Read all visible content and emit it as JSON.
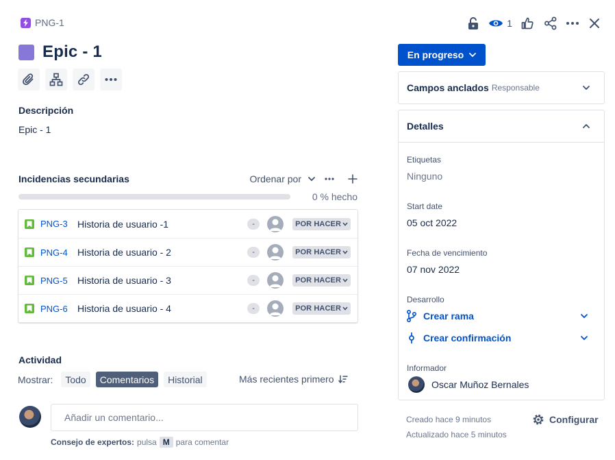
{
  "breadcrumb": {
    "key": "PNG-1"
  },
  "top_actions": {
    "watch_count": "1"
  },
  "issue": {
    "title": "Epic - 1"
  },
  "description": {
    "label": "Descripción",
    "text": "Epic - 1"
  },
  "child_issues": {
    "label": "Incidencias secundarias",
    "sort_label": "Ordenar por",
    "progress_percent": 0,
    "progress_label": "0 % hecho",
    "items": [
      {
        "key": "PNG-3",
        "summary": "Historia de usuario -1",
        "priority": "-",
        "status": "POR HACER"
      },
      {
        "key": "PNG-4",
        "summary": "Historia de usuario - 2",
        "priority": "-",
        "status": "POR HACER"
      },
      {
        "key": "PNG-5",
        "summary": "Historia de usuario - 3",
        "priority": "-",
        "status": "POR HACER"
      },
      {
        "key": "PNG-6",
        "summary": "Historia de usuario - 4",
        "priority": "-",
        "status": "POR HACER"
      }
    ]
  },
  "activity": {
    "label": "Actividad",
    "show_label": "Mostrar:",
    "filters": [
      "Todo",
      "Comentarios",
      "Historial"
    ],
    "active_filter": "Comentarios",
    "sort_label": "Más recientes primero",
    "comment_placeholder": "Añadir un comentario...",
    "tip_bold": "Consejo de expertos:",
    "tip_pre": "pulsa",
    "tip_key": "M",
    "tip_post": "para comentar"
  },
  "sidebar": {
    "status_button": "En progreso",
    "pinned_title": "Campos anclados",
    "pinned_subtitle": "Responsable",
    "details_title": "Detalles",
    "labels_label": "Etiquetas",
    "labels_value": "Ninguno",
    "start_date_label": "Start date",
    "start_date_value": "05 oct 2022",
    "due_date_label": "Fecha de vencimiento",
    "due_date_value": "07 nov 2022",
    "development_label": "Desarrollo",
    "create_branch": "Crear rama",
    "create_commit": "Crear confirmación",
    "reporter_label": "Informador",
    "reporter_name": "Oscar Muñoz Bernales",
    "created": "Creado hace 9 minutos",
    "updated": "Actualizado hace 5 minutos",
    "configure": "Configurar"
  },
  "colors": {
    "primary": "#0052cc",
    "epic": "#904ee2",
    "epic_square": "#8777d9",
    "story": "#63ba3c",
    "active_chip": "#505f79"
  }
}
